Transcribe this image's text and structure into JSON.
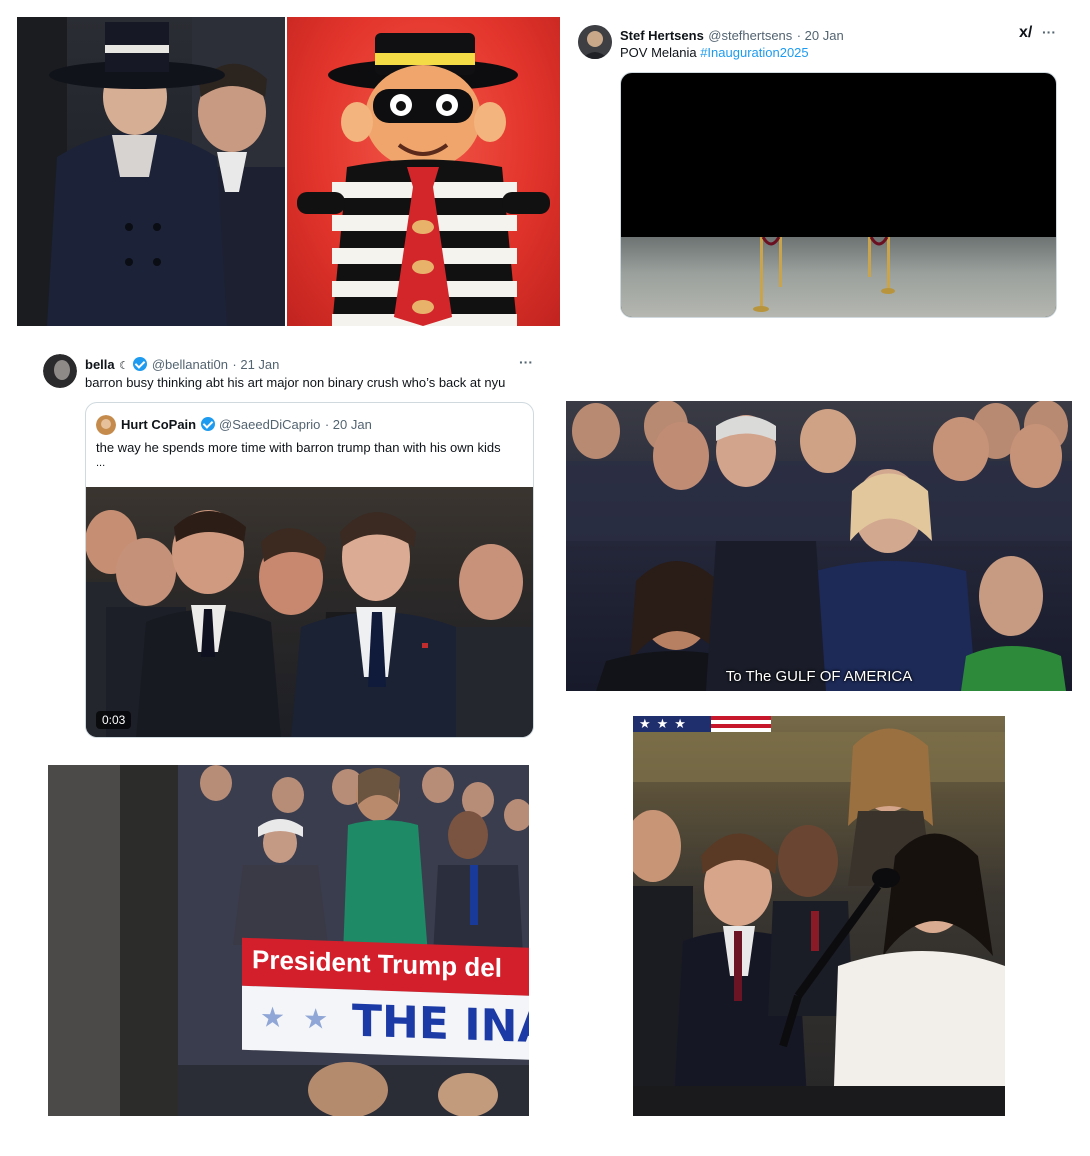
{
  "tweet_pov": {
    "name": "Stef Hertsens",
    "handle": "@stefhertsens",
    "date": "· 20 Jan",
    "text_prefix": "POV Melania ",
    "hashtag": "#Inauguration2025",
    "grok_icon_text": "x/",
    "more_icon_text": "···"
  },
  "tweet_bella": {
    "name": "bella",
    "name_badge": "☾",
    "handle": "@bellanati0n",
    "date": "· 21 Jan",
    "text": "barron busy thinking abt his art major non binary crush who’s back at nyu",
    "more_icon_text": "···",
    "quote": {
      "name": "Hurt CoPain",
      "handle": "@SaeedDiCaprio",
      "date": "· 20 Jan",
      "text": "the way he spends more time with barron trump than with his own kids",
      "ellipsis": "...",
      "video_duration": "0:03"
    }
  },
  "screenshot_caption": "To The GULF OF AMERICA",
  "tv_banner": {
    "line1": "President Trump del",
    "line2": "THE INAUG"
  },
  "colors": {
    "link_blue": "#1d9bf0",
    "banner_red": "#d31f2b",
    "banner_blue": "#1b3aa6"
  }
}
